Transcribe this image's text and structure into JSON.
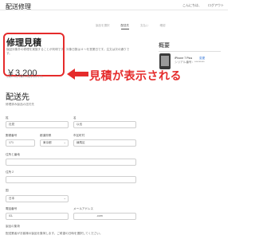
{
  "header": {
    "site_title": "配送修理",
    "links": [
      "こんにちは、",
      "ログアウト"
    ]
  },
  "steps": [
    "製品を選択",
    "配送先",
    "支払い",
    "確認"
  ],
  "estimate": {
    "title": "修理見積",
    "description": "保証対象外の修理を実施することが判明です。対象日数は 8 ～を営業日です。注文は次の通りです。",
    "price": "￥3,200",
    "note": "上記に以上で発行可能なものです。"
  },
  "callout": {
    "text": "見積が表示される",
    "color": "#e52b2b"
  },
  "summary": {
    "title": "概要",
    "product_name": "iPhone 7 Plus",
    "change_link": "変更",
    "serial": "シリアル番号：*********"
  },
  "delivery": {
    "title": "配送先",
    "subtitle": "修理済み製品の送付先",
    "fields": {
      "last_name": {
        "label": "姓",
        "value": "社見"
      },
      "first_name": {
        "label": "名",
        "value": "以也"
      },
      "postal": {
        "label": "郵便番号",
        "value": "171"
      },
      "prefecture": {
        "label": "都道府県",
        "value": "東京都"
      },
      "city": {
        "label": "市区町村",
        "value": "練馬区"
      },
      "address1": {
        "label": "住所と番地",
        "value": ""
      },
      "address2": {
        "label": "住所 2",
        "value": ""
      },
      "country": {
        "label": "国",
        "value": "日本"
      },
      "phone": {
        "label": "電話番号",
        "value": "03-"
      },
      "email": {
        "label": "メールアドレス",
        "value": ".com"
      }
    },
    "notes": {
      "heading": "製品の集荷",
      "body": "配送業者がお客様の製品を集荷します。ご希望の日時を選択してください。"
    }
  }
}
